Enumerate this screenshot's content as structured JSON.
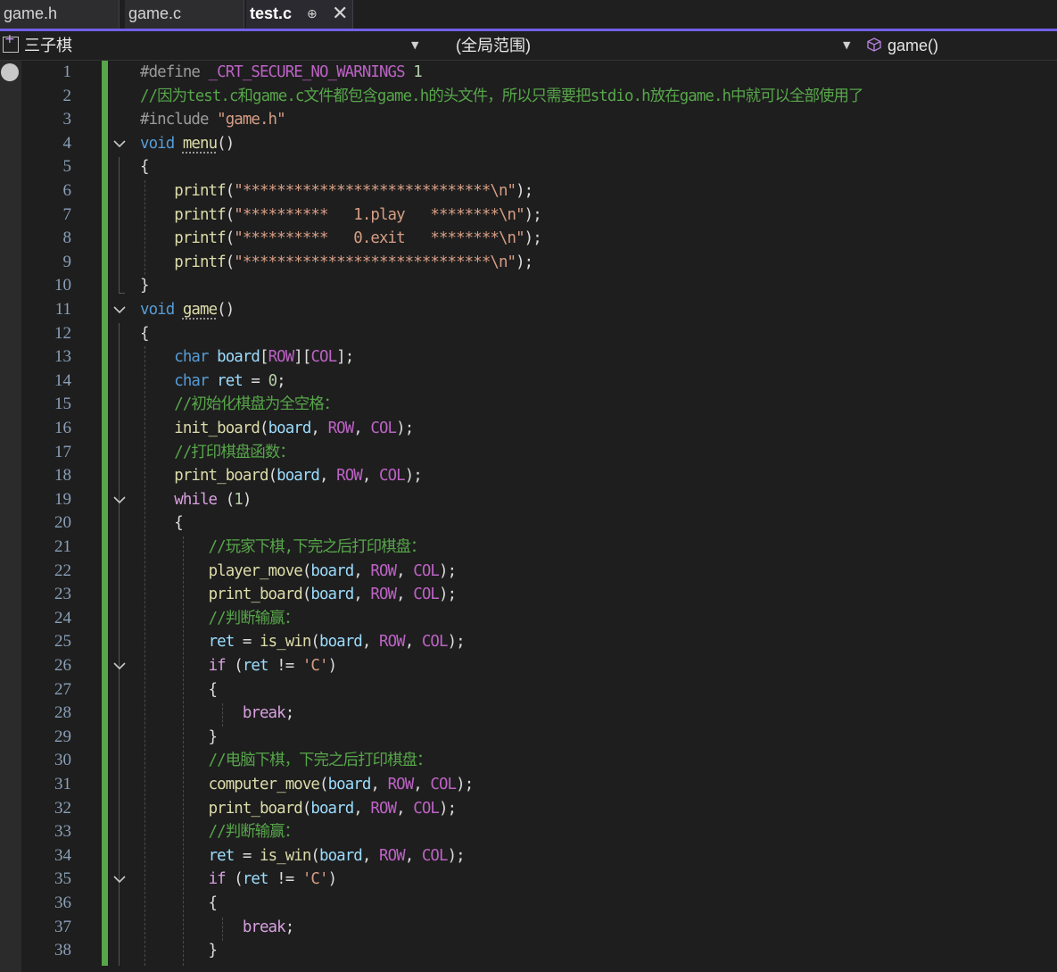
{
  "tabs": [
    {
      "label": "game.h"
    },
    {
      "label": "game.c"
    },
    {
      "label": "test.c",
      "pin": "⊕",
      "close": "✕"
    }
  ],
  "navbar": {
    "project": "三子棋",
    "scope": "(全局范围)",
    "member": "game()"
  },
  "editor": {
    "line_numbers": [
      "1",
      "2",
      "3",
      "4",
      "5",
      "6",
      "7",
      "8",
      "9",
      "10",
      "11",
      "12",
      "13",
      "14",
      "15",
      "16",
      "17",
      "18",
      "19",
      "20",
      "21",
      "22",
      "23",
      "24",
      "25",
      "26",
      "27",
      "28",
      "29",
      "30",
      "31",
      "32",
      "33",
      "34",
      "35",
      "36",
      "37",
      "38"
    ],
    "fold_lines": [
      4,
      11,
      19,
      26,
      35
    ],
    "lines": [
      [
        [
          "p",
          "#define "
        ],
        [
          "m",
          "_CRT_SECURE_NO_WARNINGS"
        ],
        [
          "t",
          " "
        ],
        [
          "n",
          "1"
        ]
      ],
      [
        [
          "c",
          "//因为test.c和game.c文件都包含game.h的头文件，所以只需要把stdio.h放在game.h中就可以全部使用了"
        ]
      ],
      [
        [
          "p",
          "#include "
        ],
        [
          "s",
          "\"game.h\""
        ]
      ],
      [
        [
          "k",
          "void"
        ],
        [
          "t",
          " "
        ],
        [
          "fsq",
          "menu"
        ],
        [
          "t",
          "()"
        ]
      ],
      [
        [
          "t",
          "{"
        ]
      ],
      [
        [
          "t",
          "    "
        ],
        [
          "f",
          "printf"
        ],
        [
          "t",
          "("
        ],
        [
          "s",
          "\"*****************************\\n\""
        ],
        [
          "t",
          ");"
        ]
      ],
      [
        [
          "t",
          "    "
        ],
        [
          "f",
          "printf"
        ],
        [
          "t",
          "("
        ],
        [
          "s",
          "\"**********   1.play   ********\\n\""
        ],
        [
          "t",
          ");"
        ]
      ],
      [
        [
          "t",
          "    "
        ],
        [
          "f",
          "printf"
        ],
        [
          "t",
          "("
        ],
        [
          "s",
          "\"**********   0.exit   ********\\n\""
        ],
        [
          "t",
          ");"
        ]
      ],
      [
        [
          "t",
          "    "
        ],
        [
          "f",
          "printf"
        ],
        [
          "t",
          "("
        ],
        [
          "s",
          "\"*****************************\\n\""
        ],
        [
          "t",
          ");"
        ]
      ],
      [
        [
          "t",
          "}"
        ]
      ],
      [
        [
          "k",
          "void"
        ],
        [
          "t",
          " "
        ],
        [
          "fsq",
          "game"
        ],
        [
          "t",
          "()"
        ]
      ],
      [
        [
          "t",
          "{"
        ]
      ],
      [
        [
          "t",
          "    "
        ],
        [
          "k",
          "char"
        ],
        [
          "t",
          " "
        ],
        [
          "v",
          "board"
        ],
        [
          "t",
          "["
        ],
        [
          "m",
          "ROW"
        ],
        [
          "t",
          "]["
        ],
        [
          "m",
          "COL"
        ],
        [
          "t",
          "];"
        ]
      ],
      [
        [
          "t",
          "    "
        ],
        [
          "k",
          "char"
        ],
        [
          "t",
          " "
        ],
        [
          "v",
          "ret"
        ],
        [
          "t",
          " = "
        ],
        [
          "n",
          "0"
        ],
        [
          "t",
          ";"
        ]
      ],
      [
        [
          "t",
          "    "
        ],
        [
          "c",
          "//初始化棋盘为全空格："
        ]
      ],
      [
        [
          "t",
          "    "
        ],
        [
          "f",
          "init_board"
        ],
        [
          "t",
          "("
        ],
        [
          "v",
          "board"
        ],
        [
          "t",
          ", "
        ],
        [
          "m",
          "ROW"
        ],
        [
          "t",
          ", "
        ],
        [
          "m",
          "COL"
        ],
        [
          "t",
          ");"
        ]
      ],
      [
        [
          "t",
          "    "
        ],
        [
          "c",
          "//打印棋盘函数："
        ]
      ],
      [
        [
          "t",
          "    "
        ],
        [
          "f",
          "print_board"
        ],
        [
          "t",
          "("
        ],
        [
          "v",
          "board"
        ],
        [
          "t",
          ", "
        ],
        [
          "m",
          "ROW"
        ],
        [
          "t",
          ", "
        ],
        [
          "m",
          "COL"
        ],
        [
          "t",
          ");"
        ]
      ],
      [
        [
          "t",
          "    "
        ],
        [
          "cf",
          "while"
        ],
        [
          "t",
          " ("
        ],
        [
          "n",
          "1"
        ],
        [
          "t",
          ")"
        ]
      ],
      [
        [
          "t",
          "    {"
        ]
      ],
      [
        [
          "t",
          "        "
        ],
        [
          "c",
          "//玩家下棋,下完之后打印棋盘："
        ]
      ],
      [
        [
          "t",
          "        "
        ],
        [
          "f",
          "player_move"
        ],
        [
          "t",
          "("
        ],
        [
          "v",
          "board"
        ],
        [
          "t",
          ", "
        ],
        [
          "m",
          "ROW"
        ],
        [
          "t",
          ", "
        ],
        [
          "m",
          "COL"
        ],
        [
          "t",
          ");"
        ]
      ],
      [
        [
          "t",
          "        "
        ],
        [
          "f",
          "print_board"
        ],
        [
          "t",
          "("
        ],
        [
          "v",
          "board"
        ],
        [
          "t",
          ", "
        ],
        [
          "m",
          "ROW"
        ],
        [
          "t",
          ", "
        ],
        [
          "m",
          "COL"
        ],
        [
          "t",
          ");"
        ]
      ],
      [
        [
          "t",
          "        "
        ],
        [
          "c",
          "//判断输赢："
        ]
      ],
      [
        [
          "t",
          "        "
        ],
        [
          "v",
          "ret"
        ],
        [
          "t",
          " = "
        ],
        [
          "f",
          "is_win"
        ],
        [
          "t",
          "("
        ],
        [
          "v",
          "board"
        ],
        [
          "t",
          ", "
        ],
        [
          "m",
          "ROW"
        ],
        [
          "t",
          ", "
        ],
        [
          "m",
          "COL"
        ],
        [
          "t",
          ");"
        ]
      ],
      [
        [
          "t",
          "        "
        ],
        [
          "cf",
          "if"
        ],
        [
          "t",
          " ("
        ],
        [
          "v",
          "ret"
        ],
        [
          "t",
          " != "
        ],
        [
          "s",
          "'C'"
        ],
        [
          "t",
          ")"
        ]
      ],
      [
        [
          "t",
          "        {"
        ]
      ],
      [
        [
          "t",
          "            "
        ],
        [
          "cf",
          "break"
        ],
        [
          "t",
          ";"
        ]
      ],
      [
        [
          "t",
          "        }"
        ]
      ],
      [
        [
          "t",
          "        "
        ],
        [
          "c",
          "//电脑下棋，下完之后打印棋盘："
        ]
      ],
      [
        [
          "t",
          "        "
        ],
        [
          "f",
          "computer_move"
        ],
        [
          "t",
          "("
        ],
        [
          "v",
          "board"
        ],
        [
          "t",
          ", "
        ],
        [
          "m",
          "ROW"
        ],
        [
          "t",
          ", "
        ],
        [
          "m",
          "COL"
        ],
        [
          "t",
          ");"
        ]
      ],
      [
        [
          "t",
          "        "
        ],
        [
          "f",
          "print_board"
        ],
        [
          "t",
          "("
        ],
        [
          "v",
          "board"
        ],
        [
          "t",
          ", "
        ],
        [
          "m",
          "ROW"
        ],
        [
          "t",
          ", "
        ],
        [
          "m",
          "COL"
        ],
        [
          "t",
          ");"
        ]
      ],
      [
        [
          "t",
          "        "
        ],
        [
          "c",
          "//判断输赢："
        ]
      ],
      [
        [
          "t",
          "        "
        ],
        [
          "v",
          "ret"
        ],
        [
          "t",
          " = "
        ],
        [
          "f",
          "is_win"
        ],
        [
          "t",
          "("
        ],
        [
          "v",
          "board"
        ],
        [
          "t",
          ", "
        ],
        [
          "m",
          "ROW"
        ],
        [
          "t",
          ", "
        ],
        [
          "m",
          "COL"
        ],
        [
          "t",
          ");"
        ]
      ],
      [
        [
          "t",
          "        "
        ],
        [
          "cf",
          "if"
        ],
        [
          "t",
          " ("
        ],
        [
          "v",
          "ret"
        ],
        [
          "t",
          " != "
        ],
        [
          "s",
          "'C'"
        ],
        [
          "t",
          ")"
        ]
      ],
      [
        [
          "t",
          "        {"
        ]
      ],
      [
        [
          "t",
          "            "
        ],
        [
          "cf",
          "break"
        ],
        [
          "t",
          ";"
        ]
      ],
      [
        [
          "t",
          "        }"
        ]
      ]
    ]
  },
  "colors": {
    "accent": "#7160e8",
    "change_bar": "#57a64a",
    "background": "#1e1e1e"
  }
}
